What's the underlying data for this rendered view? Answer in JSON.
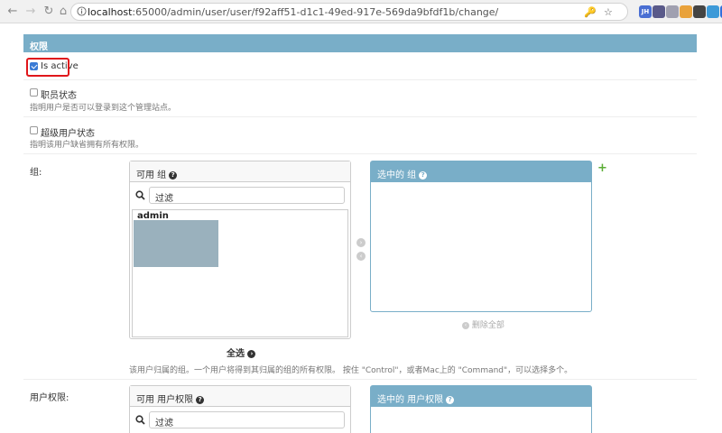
{
  "browser": {
    "url_host": "localhost",
    "url_rest": ":65000/admin/user/user/f92aff51-d1c1-49ed-917e-569da9bfdf1b/change/",
    "extensions": [
      {
        "name": "ext-jh-icon",
        "label": "JH",
        "color": "#4a6fd3"
      },
      {
        "name": "ext-circle-icon",
        "label": "",
        "color": "#5a5a8a"
      },
      {
        "name": "ext-react-icon",
        "label": "",
        "color": "#a0a0b0"
      },
      {
        "name": "ext-orange-icon",
        "label": "",
        "color": "#e9a23b"
      },
      {
        "name": "ext-grid-icon",
        "label": "",
        "color": "#444444"
      },
      {
        "name": "ext-globe-icon",
        "label": "",
        "color": "#3c9ad8"
      },
      {
        "name": "ext-x-icon",
        "label": "",
        "color": "#2f6fdc"
      }
    ]
  },
  "permissions": {
    "header": "权限",
    "is_active_label": "Is active",
    "is_staff_label": "职员状态",
    "is_staff_help": "指明用户是否可以登录到这个管理站点。",
    "is_superuser_label": "超级用户状态",
    "is_superuser_help": "指明该用户缺省拥有所有权限。"
  },
  "groups": {
    "label": "组:",
    "available_header": "可用 组",
    "chosen_header": "选中的 组",
    "filter_placeholder": "过滤",
    "available_items": [
      "admin"
    ],
    "choose_all": "全选",
    "remove_all": "删除全部",
    "help": "该用户归属的组。一个用户将得到其归属的组的所有权限。 按住 \"Control\"，或者Mac上的 \"Command\"，可以选择多个。"
  },
  "user_permissions": {
    "label": "用户权限:",
    "available_header": "可用 用户权限",
    "chosen_header": "选中的 用户权限",
    "filter_placeholder": "过滤"
  }
}
